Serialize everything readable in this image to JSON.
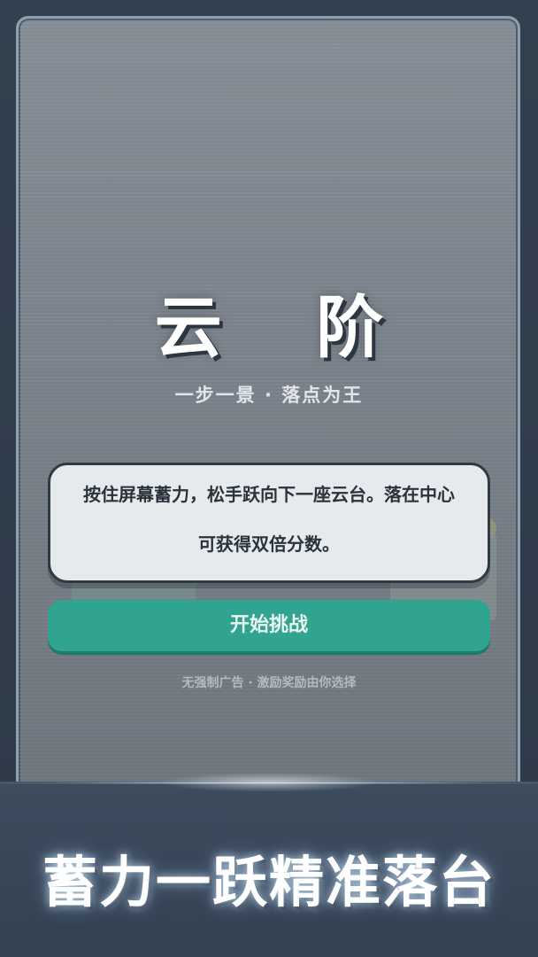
{
  "game": {
    "title": "云 阶",
    "subtitle": "一步一景 · 落点为王",
    "instructions": "按住屏幕蓄力，松手跃向下一座云台。落在中心可获得双倍分数。",
    "start_label": "开始挑战",
    "note": "无强制广告 · 激励奖励由你选择"
  },
  "promo": {
    "slogan": "蓄力一跃精准落台"
  },
  "colors": {
    "accent": "#30a48e",
    "card": "#e6eaec",
    "banner": "#3d4c5e"
  }
}
